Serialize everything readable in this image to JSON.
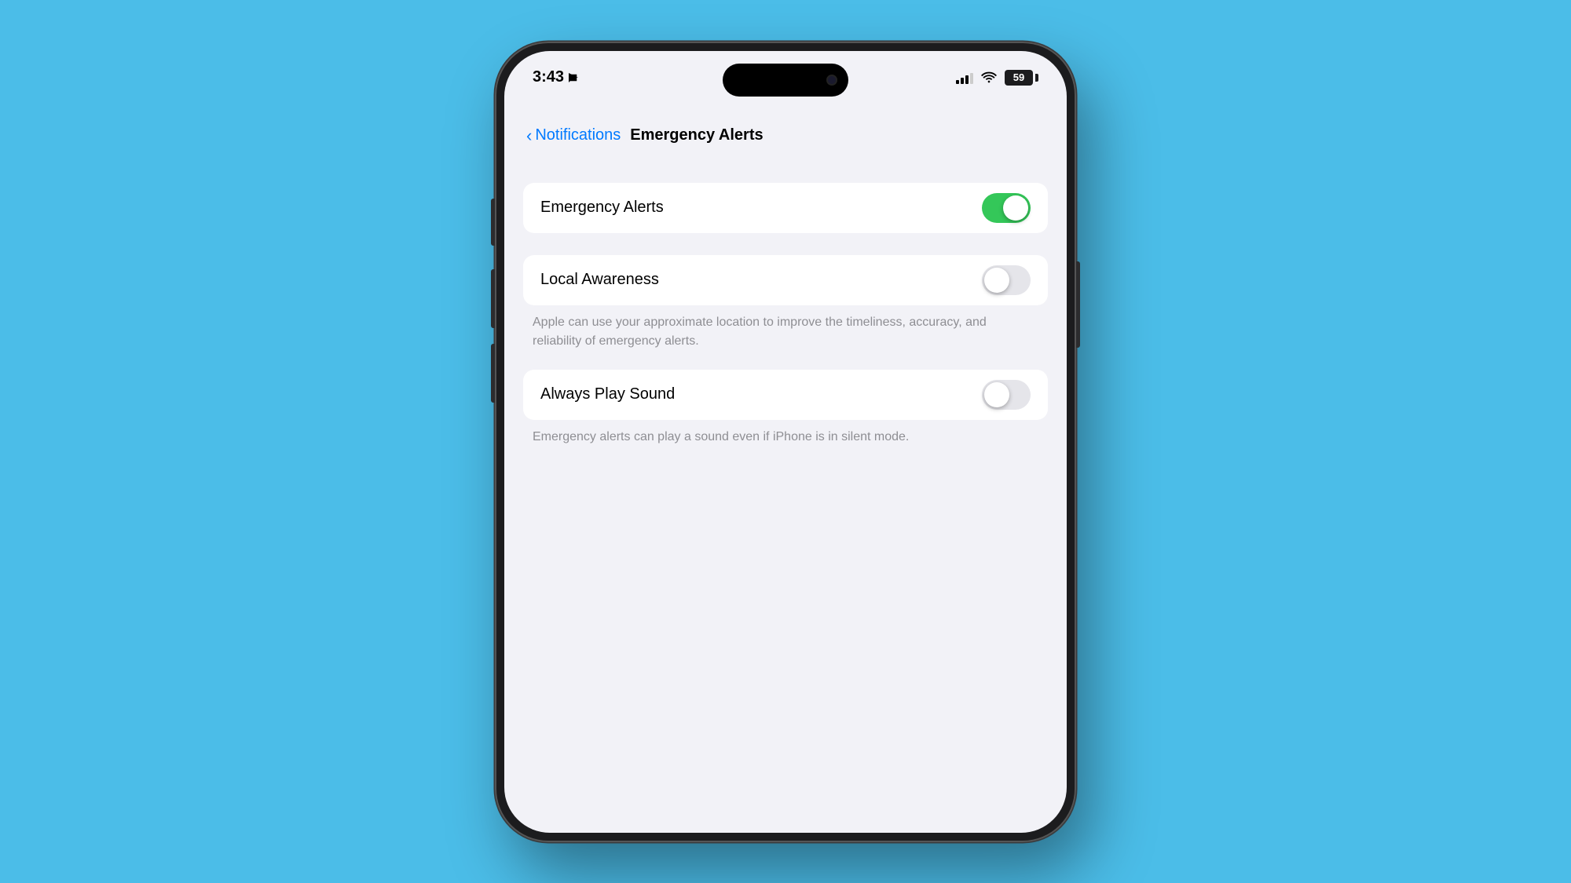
{
  "background": "#4bbde8",
  "statusBar": {
    "time": "3:43",
    "battery": "59",
    "hasLocation": true
  },
  "navigation": {
    "backLabel": "Notifications",
    "pageTitle": "Emergency Alerts"
  },
  "settings": {
    "emergencyAlerts": {
      "label": "Emergency Alerts",
      "enabled": true
    },
    "localAwareness": {
      "label": "Local Awareness",
      "enabled": false,
      "description": "Apple can use your approximate location to improve the timeliness, accuracy, and reliability of emergency alerts."
    },
    "alwaysPlaySound": {
      "label": "Always Play Sound",
      "enabled": false,
      "description": "Emergency alerts can play a sound even if iPhone is in silent mode."
    }
  }
}
